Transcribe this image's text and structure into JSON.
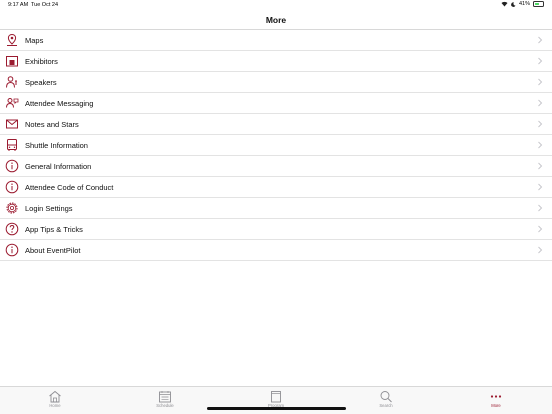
{
  "status_bar": {
    "time": "9:17 AM",
    "date": "Tue Oct 24",
    "battery": "41%",
    "battery_level": 0.41
  },
  "header": {
    "title": "More"
  },
  "accent_color": "#9b1b30",
  "menu": [
    {
      "label": "Maps",
      "icon": "map-pin-icon"
    },
    {
      "label": "Exhibitors",
      "icon": "exhibitor-booth-icon"
    },
    {
      "label": "Speakers",
      "icon": "speaker-person-icon"
    },
    {
      "label": "Attendee Messaging",
      "icon": "messaging-people-icon"
    },
    {
      "label": "Notes and Stars",
      "icon": "envelope-icon"
    },
    {
      "label": "Shuttle Information",
      "icon": "bus-icon"
    },
    {
      "label": "General Information",
      "icon": "info-icon"
    },
    {
      "label": "Attendee Code of Conduct",
      "icon": "info-icon"
    },
    {
      "label": "Login Settings",
      "icon": "gear-icon"
    },
    {
      "label": "App Tips & Tricks",
      "icon": "question-icon"
    },
    {
      "label": "About EventPilot",
      "icon": "info-icon"
    }
  ],
  "tab_bar": {
    "tabs": [
      {
        "label": "Home",
        "icon": "home-icon"
      },
      {
        "label": "Schedule",
        "icon": "calendar-icon"
      },
      {
        "label": "Program",
        "icon": "book-icon"
      },
      {
        "label": "Search",
        "icon": "search-icon"
      },
      {
        "label": "More",
        "icon": "more-dots-icon",
        "active": true
      }
    ]
  }
}
